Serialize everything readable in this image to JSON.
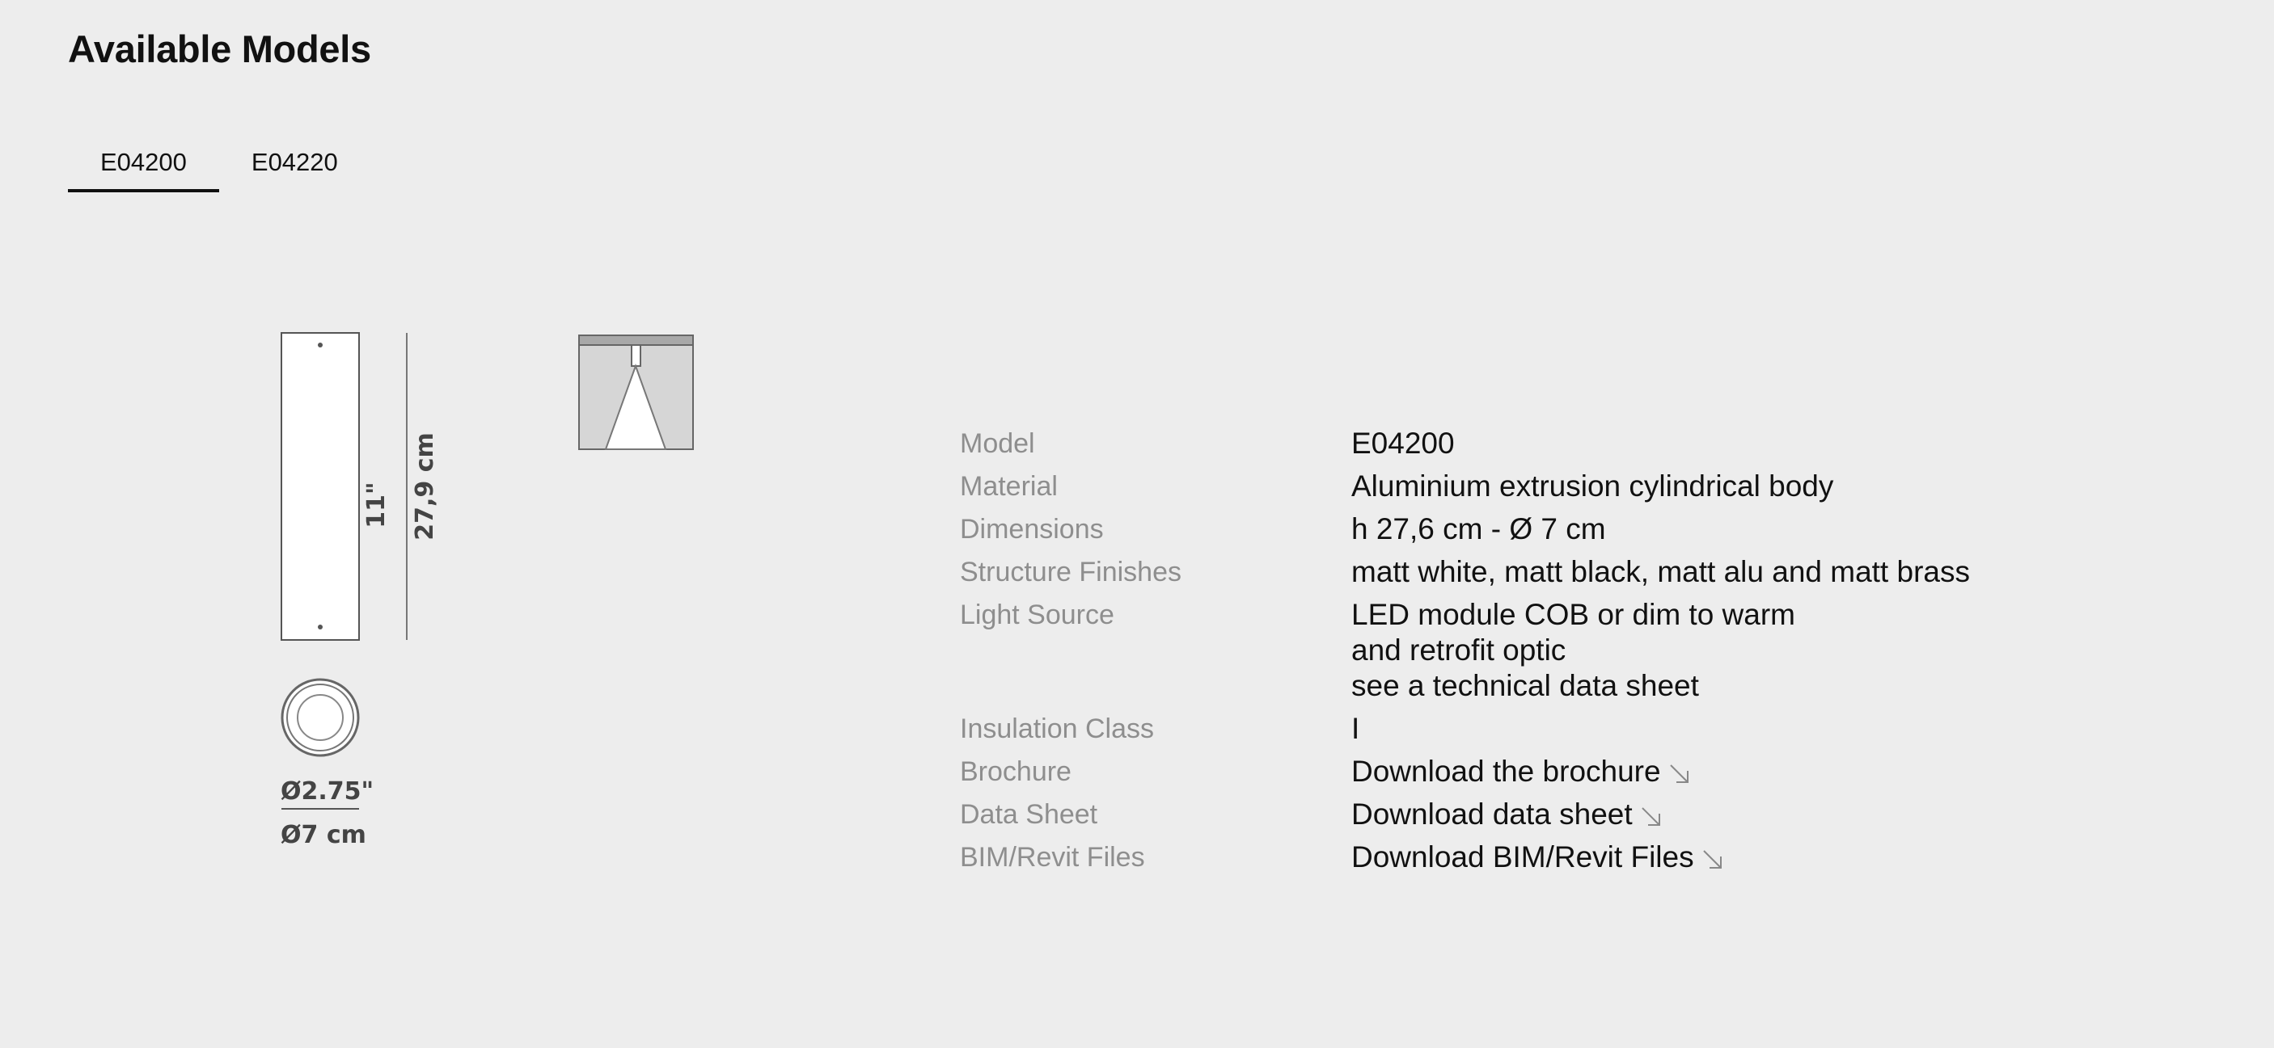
{
  "page": {
    "title": "Available Models"
  },
  "tabs": [
    {
      "label": "E04200",
      "active": true
    },
    {
      "label": "E04220",
      "active": false
    }
  ],
  "drawing": {
    "height_in": "11\"",
    "height_cm": "27,9 cm",
    "diameter_in": "Ø2.75\"",
    "diameter_cm": "Ø7 cm"
  },
  "specs": {
    "model": {
      "label": "Model",
      "value": "E04200"
    },
    "material": {
      "label": "Material",
      "value": "Aluminium extrusion cylindrical body"
    },
    "dimensions": {
      "label": "Dimensions",
      "value": "h 27,6 cm - Ø 7 cm"
    },
    "finishes": {
      "label": "Structure Finishes",
      "value": "matt white, matt black, matt alu and matt brass"
    },
    "light_source": {
      "label": "Light Source",
      "lines": [
        "LED module COB or dim to warm",
        "and retrofit optic",
        "see a technical data sheet"
      ]
    },
    "insulation": {
      "label": "Insulation Class",
      "value": "I"
    },
    "brochure": {
      "label": "Brochure",
      "link": "Download the brochure"
    },
    "data_sheet": {
      "label": "Data Sheet",
      "link": "Download data sheet"
    },
    "bim": {
      "label": "BIM/Revit Files",
      "link": "Download BIM/Revit Files"
    }
  },
  "icons": {
    "download": "arrow-down-right-icon"
  },
  "colors": {
    "background": "#ededed",
    "text": "#111111",
    "label": "#8e8e8e"
  }
}
